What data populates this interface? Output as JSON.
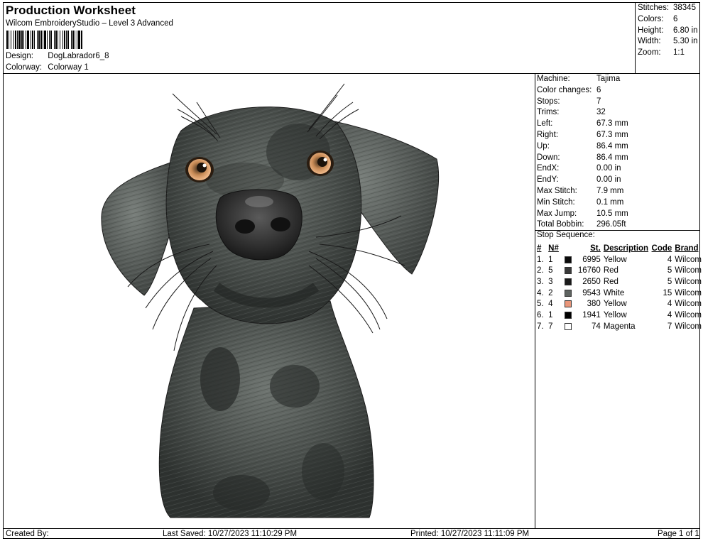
{
  "header": {
    "title": "Production Worksheet",
    "software": "Wilcom EmbroideryStudio – Level 3 Advanced",
    "design_label": "Design:",
    "design_value": "DogLabrador6_8",
    "colorway_label": "Colorway:",
    "colorway_value": "Colorway 1"
  },
  "stats": [
    {
      "label": "Stitches:",
      "value": "38345"
    },
    {
      "label": "Colors:",
      "value": "6"
    },
    {
      "label": "Height:",
      "value": "6.80 in"
    },
    {
      "label": "Width:",
      "value": "5.30 in"
    },
    {
      "label": "Zoom:",
      "value": "1:1"
    }
  ],
  "machine_info": [
    {
      "label": "Machine:",
      "value": "Tajima"
    },
    {
      "label": "Color changes:",
      "value": "6"
    },
    {
      "label": "Stops:",
      "value": "7"
    },
    {
      "label": "Trims:",
      "value": "32"
    },
    {
      "label": "Left:",
      "value": "67.3 mm"
    },
    {
      "label": "Right:",
      "value": "67.3 mm"
    },
    {
      "label": "Up:",
      "value": "86.4 mm"
    },
    {
      "label": "Down:",
      "value": "86.4 mm"
    },
    {
      "label": "EndX:",
      "value": "0.00 in"
    },
    {
      "label": "EndY:",
      "value": "0.00 in"
    },
    {
      "label": "Max Stitch:",
      "value": "7.9 mm"
    },
    {
      "label": "Min Stitch:",
      "value": "0.1 mm"
    },
    {
      "label": "Max Jump:",
      "value": "10.5 mm"
    },
    {
      "label": "Total Bobbin:",
      "value": "296.05ft"
    }
  ],
  "stop_sequence": {
    "label": "Stop Sequence:",
    "columns": {
      "num": "#",
      "needle": "N#",
      "stitches": "St.",
      "description": "Description",
      "code": "Code",
      "brand": "Brand"
    },
    "rows": [
      {
        "num": "1.",
        "needle": "1",
        "color": "#0a0a0a",
        "stitches": "6995",
        "description": "Yellow",
        "code": "4",
        "brand": "Wilcom"
      },
      {
        "num": "2.",
        "needle": "5",
        "color": "#3a3a3a",
        "stitches": "16760",
        "description": "Red",
        "code": "5",
        "brand": "Wilcom"
      },
      {
        "num": "3.",
        "needle": "3",
        "color": "#1a1a1a",
        "stitches": "2650",
        "description": "Red",
        "code": "5",
        "brand": "Wilcom"
      },
      {
        "num": "4.",
        "needle": "2",
        "color": "#5e6360",
        "stitches": "9543",
        "description": "White",
        "code": "15",
        "brand": "Wilcom"
      },
      {
        "num": "5.",
        "needle": "4",
        "color": "#e9967a",
        "stitches": "380",
        "description": "Yellow",
        "code": "4",
        "brand": "Wilcom"
      },
      {
        "num": "6.",
        "needle": "1",
        "color": "#000000",
        "stitches": "1941",
        "description": "Yellow",
        "code": "4",
        "brand": "Wilcom"
      },
      {
        "num": "7.",
        "needle": "7",
        "color": "#ffffff",
        "stitches": "74",
        "description": "Magenta",
        "code": "7",
        "brand": "Wilcom"
      }
    ]
  },
  "footer": {
    "created_by": "Created By:",
    "last_saved": "Last Saved: 10/27/2023 11:10:29 PM",
    "printed": "Printed: 10/27/2023 11:11:09 PM",
    "page": "Page 1 of 1"
  }
}
